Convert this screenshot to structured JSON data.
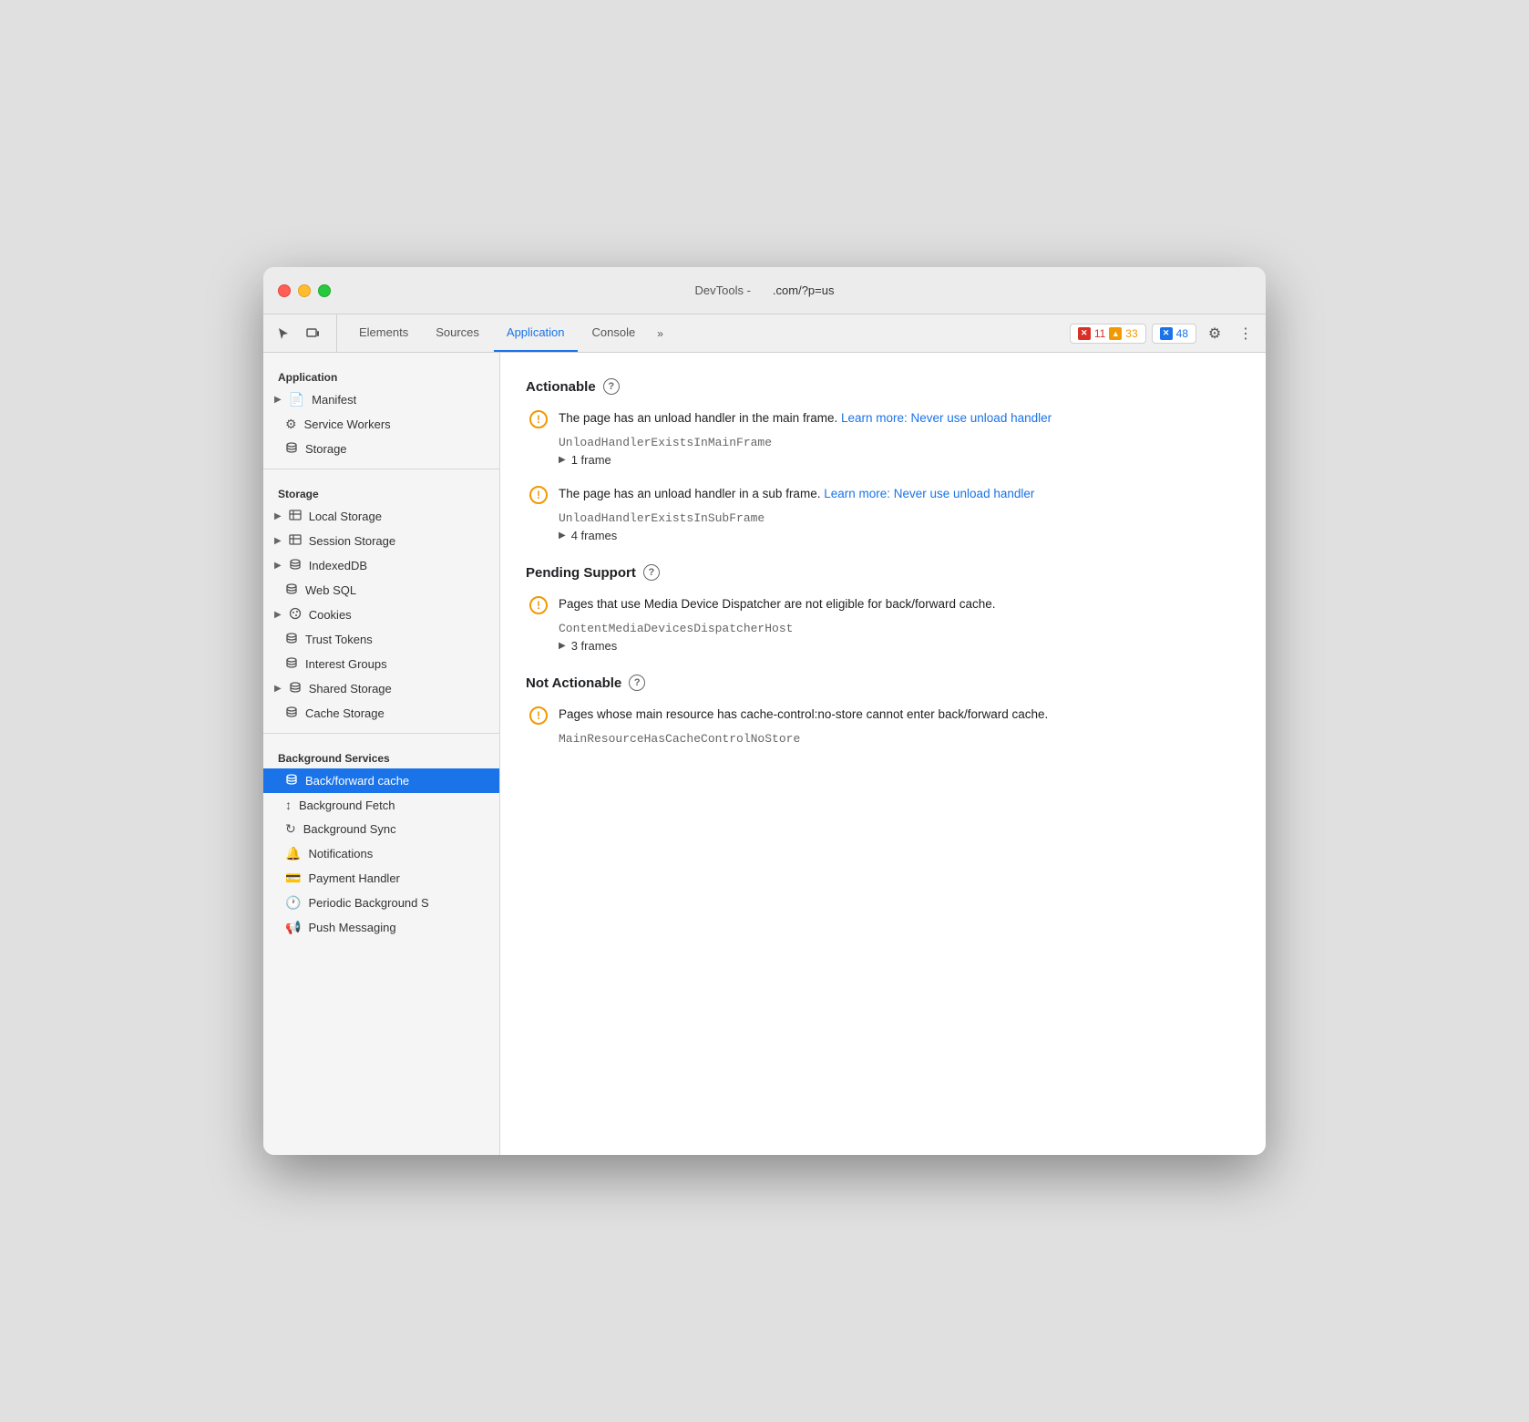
{
  "window": {
    "title_devtools": "DevTools -",
    "title_url": ".com/?p=us"
  },
  "tabs": {
    "items": [
      {
        "id": "elements",
        "label": "Elements"
      },
      {
        "id": "sources",
        "label": "Sources"
      },
      {
        "id": "application",
        "label": "Application",
        "active": true
      },
      {
        "id": "console",
        "label": "Console"
      }
    ],
    "overflow_label": "»",
    "badges": {
      "errors": {
        "count": "11",
        "icon": "✕"
      },
      "warnings": {
        "count": "33",
        "icon": "▲"
      },
      "info": {
        "count": "48",
        "icon": "✕"
      }
    }
  },
  "sidebar": {
    "app_section": "Application",
    "app_items": [
      {
        "id": "manifest",
        "label": "Manifest",
        "icon": "📄",
        "arrow": true
      },
      {
        "id": "service-workers",
        "label": "Service Workers",
        "icon": "⚙️"
      },
      {
        "id": "storage",
        "label": "Storage",
        "icon": "🗄️"
      }
    ],
    "storage_section": "Storage",
    "storage_items": [
      {
        "id": "local-storage",
        "label": "Local Storage",
        "icon": "▦",
        "arrow": true
      },
      {
        "id": "session-storage",
        "label": "Session Storage",
        "icon": "▦",
        "arrow": true
      },
      {
        "id": "indexeddb",
        "label": "IndexedDB",
        "icon": "🗄️",
        "arrow": true
      },
      {
        "id": "web-sql",
        "label": "Web SQL",
        "icon": "🗄️"
      },
      {
        "id": "cookies",
        "label": "Cookies",
        "icon": "🍪",
        "arrow": true
      },
      {
        "id": "trust-tokens",
        "label": "Trust Tokens",
        "icon": "🗄️"
      },
      {
        "id": "interest-groups",
        "label": "Interest Groups",
        "icon": "🗄️"
      },
      {
        "id": "shared-storage",
        "label": "Shared Storage",
        "icon": "🗄️",
        "arrow": true
      },
      {
        "id": "cache-storage",
        "label": "Cache Storage",
        "icon": "🗄️"
      }
    ],
    "bg_section": "Background Services",
    "bg_items": [
      {
        "id": "back-forward-cache",
        "label": "Back/forward cache",
        "icon": "🗄️",
        "active": true
      },
      {
        "id": "background-fetch",
        "label": "Background Fetch",
        "icon": "↕"
      },
      {
        "id": "background-sync",
        "label": "Background Sync",
        "icon": "↻"
      },
      {
        "id": "notifications",
        "label": "Notifications",
        "icon": "🔔"
      },
      {
        "id": "payment-handler",
        "label": "Payment Handler",
        "icon": "💳"
      },
      {
        "id": "periodic-background",
        "label": "Periodic Background S",
        "icon": "🕐"
      },
      {
        "id": "push-messaging",
        "label": "Push Messaging",
        "icon": "📢"
      }
    ]
  },
  "content": {
    "actionable_section": {
      "title": "Actionable",
      "help": "?",
      "issues": [
        {
          "id": "unload-main",
          "text_before": "The page has an unload handler in the main frame.",
          "link_text": "Learn more: Never use unload handler",
          "link_href": "#",
          "code": "UnloadHandlerExistsInMainFrame",
          "frames_label": "1 frame"
        },
        {
          "id": "unload-sub",
          "text_before": "The page has an unload handler in a sub frame.",
          "link_text": "Learn more: Never use unload handler",
          "link_href": "#",
          "code": "UnloadHandlerExistsInSubFrame",
          "frames_label": "4 frames"
        }
      ]
    },
    "pending_section": {
      "title": "Pending Support",
      "help": "?",
      "issues": [
        {
          "id": "media-device",
          "text": "Pages that use Media Device Dispatcher are not eligible for back/forward cache.",
          "code": "ContentMediaDevicesDispatcherHost",
          "frames_label": "3 frames"
        }
      ]
    },
    "not_actionable_section": {
      "title": "Not Actionable",
      "help": "?",
      "issues": [
        {
          "id": "cache-control",
          "text": "Pages whose main resource has cache-control:no-store cannot enter back/forward cache.",
          "code": "MainResourceHasCacheControlNoStore"
        }
      ]
    }
  }
}
